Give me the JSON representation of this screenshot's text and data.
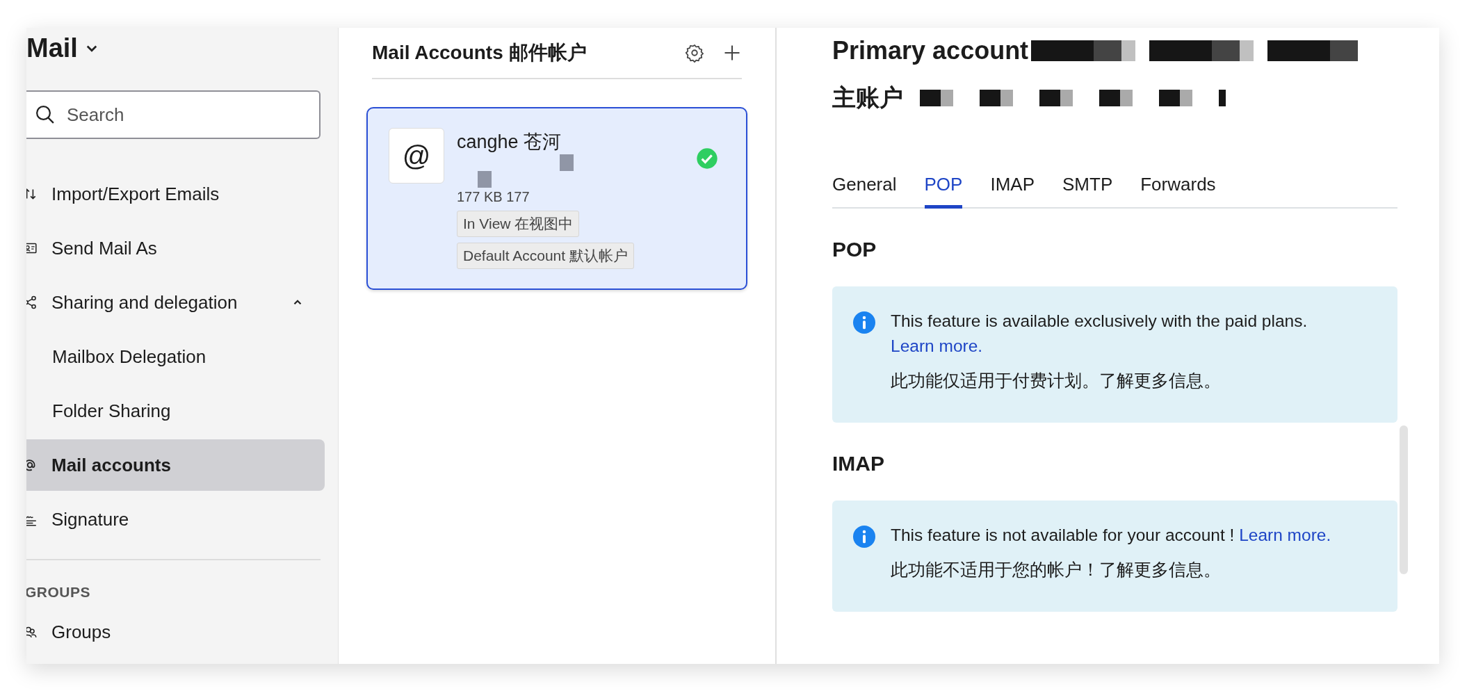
{
  "sidebar": {
    "title": "Mail",
    "search": {
      "placeholder": "Search"
    },
    "items": [
      {
        "label": "Import/Export Emails",
        "kind": "arrows",
        "selected": false
      },
      {
        "label": "Send Mail As",
        "kind": "card",
        "selected": false
      },
      {
        "label": "Sharing and delegation",
        "kind": "share",
        "selected": false,
        "expanded": true,
        "children": [
          {
            "label": "Mailbox Delegation",
            "selected": false
          },
          {
            "label": "Folder Sharing",
            "selected": false
          }
        ]
      },
      {
        "label": "Mail accounts",
        "kind": "at",
        "selected": true
      },
      {
        "label": "Signature",
        "kind": "signature",
        "selected": false
      }
    ],
    "section": "GROUPS",
    "section_items": [
      {
        "label": "Groups",
        "kind": "groups",
        "selected": false
      }
    ]
  },
  "accounts": {
    "title": "Mail Accounts 邮件帐户",
    "cards": [
      {
        "avatar": "@",
        "name": "canghe 苍河",
        "size": "177 KB 177",
        "verified": true,
        "selected": true,
        "tags": [
          "In View 在视图中",
          "Default Account 默认帐户"
        ]
      }
    ]
  },
  "detail": {
    "title": "Primary account",
    "subtitle": "主账户",
    "tabs": [
      {
        "label": "General",
        "selected": false
      },
      {
        "label": "POP",
        "selected": true
      },
      {
        "label": "IMAP",
        "selected": false
      },
      {
        "label": "SMTP",
        "selected": false
      },
      {
        "label": "Forwards",
        "selected": false
      }
    ],
    "sections": [
      {
        "heading": "POP",
        "notice": "This feature is available exclusively with the paid plans.",
        "link": "Learn more.",
        "notice_zh": "此功能仅适用于付费计划。了解更多信息。"
      },
      {
        "heading": "IMAP",
        "notice": "This feature is not available for your account !",
        "link": "Learn more.",
        "notice_zh": "此功能不适用于您的帐户！了解更多信息。"
      }
    ]
  }
}
